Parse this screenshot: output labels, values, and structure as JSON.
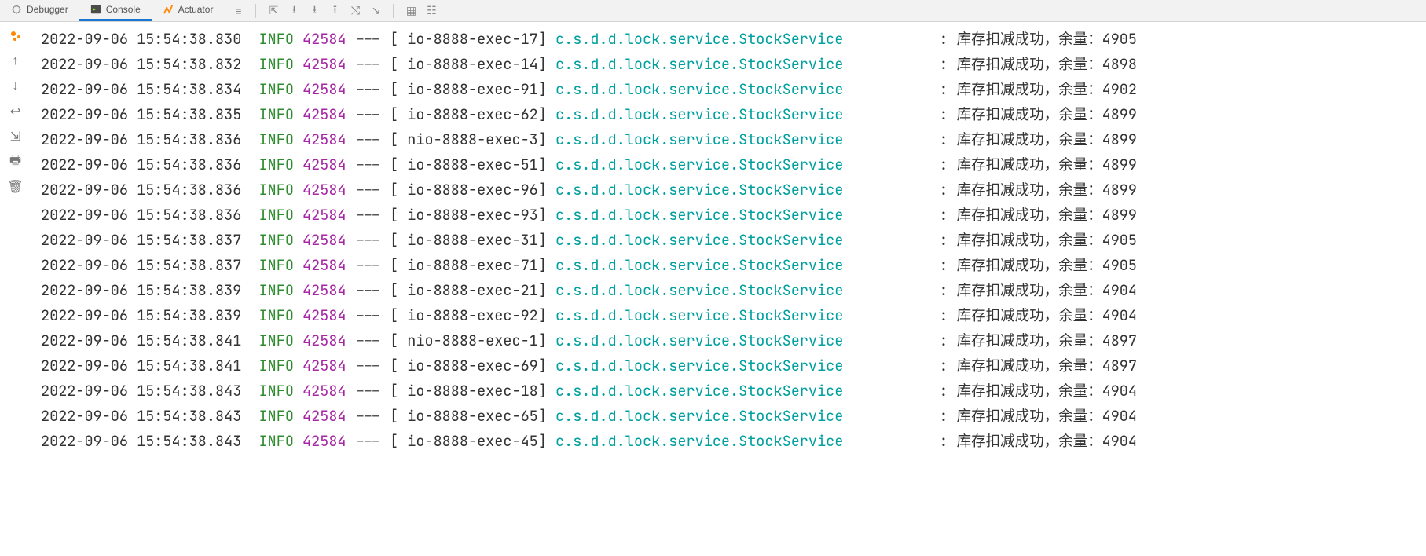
{
  "tabs": {
    "debugger": "Debugger",
    "console": "Console",
    "actuator": "Actuator"
  },
  "pid": "42584",
  "service": "c.s.d.d.lock.service.StockService",
  "msg_prefix": "库存扣减成功，余量：",
  "rows": [
    {
      "ts": "2022-09-06 15:54:38.830",
      "lvl": "INFO",
      "thr": "[ io-8888-exec-17]",
      "bal": "4905"
    },
    {
      "ts": "2022-09-06 15:54:38.832",
      "lvl": "INFO",
      "thr": "[ io-8888-exec-14]",
      "bal": "4898"
    },
    {
      "ts": "2022-09-06 15:54:38.834",
      "lvl": "INFO",
      "thr": "[ io-8888-exec-91]",
      "bal": "4902"
    },
    {
      "ts": "2022-09-06 15:54:38.835",
      "lvl": "INFO",
      "thr": "[ io-8888-exec-62]",
      "bal": "4899"
    },
    {
      "ts": "2022-09-06 15:54:38.836",
      "lvl": "INFO",
      "thr": "[ nio-8888-exec-3]",
      "bal": "4899"
    },
    {
      "ts": "2022-09-06 15:54:38.836",
      "lvl": "INFO",
      "thr": "[ io-8888-exec-51]",
      "bal": "4899"
    },
    {
      "ts": "2022-09-06 15:54:38.836",
      "lvl": "INFO",
      "thr": "[ io-8888-exec-96]",
      "bal": "4899"
    },
    {
      "ts": "2022-09-06 15:54:38.836",
      "lvl": "INFO",
      "thr": "[ io-8888-exec-93]",
      "bal": "4899"
    },
    {
      "ts": "2022-09-06 15:54:38.837",
      "lvl": "INFO",
      "thr": "[ io-8888-exec-31]",
      "bal": "4905"
    },
    {
      "ts": "2022-09-06 15:54:38.837",
      "lvl": "INFO",
      "thr": "[ io-8888-exec-71]",
      "bal": "4905"
    },
    {
      "ts": "2022-09-06 15:54:38.839",
      "lvl": "INFO",
      "thr": "[ io-8888-exec-21]",
      "bal": "4904"
    },
    {
      "ts": "2022-09-06 15:54:38.839",
      "lvl": "INFO",
      "thr": "[ io-8888-exec-92]",
      "bal": "4904"
    },
    {
      "ts": "2022-09-06 15:54:38.841",
      "lvl": "INFO",
      "thr": "[ nio-8888-exec-1]",
      "bal": "4897"
    },
    {
      "ts": "2022-09-06 15:54:38.841",
      "lvl": "INFO",
      "thr": "[ io-8888-exec-69]",
      "bal": "4897"
    },
    {
      "ts": "2022-09-06 15:54:38.843",
      "lvl": "INFO",
      "thr": "[ io-8888-exec-18]",
      "bal": "4904"
    },
    {
      "ts": "2022-09-06 15:54:38.843",
      "lvl": "INFO",
      "thr": "[ io-8888-exec-65]",
      "bal": "4904"
    },
    {
      "ts": "2022-09-06 15:54:38.843",
      "lvl": "INFO",
      "thr": "[ io-8888-exec-45]",
      "bal": "4904"
    }
  ]
}
